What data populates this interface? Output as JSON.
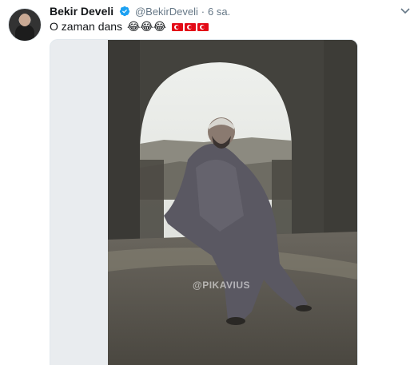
{
  "tweet": {
    "author_name": "Bekir Develi",
    "handle": "@BekirDeveli",
    "separator": "·",
    "time": "6 sa.",
    "text": "O zaman dans",
    "emoji": "😂😂😂",
    "flags": [
      "turkish-flag",
      "turkish-flag",
      "turkish-flag"
    ]
  },
  "media": {
    "watermark": "@PIKAVIUS"
  },
  "colors": {
    "verified": "#1da1f2",
    "secondary_text": "#657786",
    "primary_text": "#14171a",
    "flag_red": "#e30a17"
  },
  "icons": [
    "verified-badge-icon",
    "chevron-down-icon"
  ]
}
